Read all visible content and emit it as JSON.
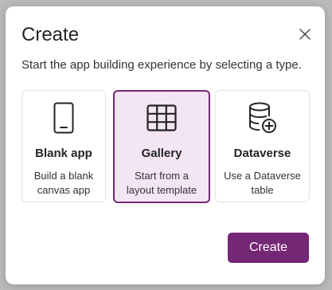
{
  "dialog": {
    "title": "Create",
    "subtitle": "Start the app building experience by selecting a type.",
    "close_icon": "close-icon"
  },
  "options": [
    {
      "id": "blank-app",
      "name": "Blank app",
      "description": "Build a blank canvas app",
      "icon": "phone-icon",
      "selected": false
    },
    {
      "id": "gallery",
      "name": "Gallery",
      "description": "Start from a layout template",
      "icon": "grid-icon",
      "selected": true
    },
    {
      "id": "dataverse",
      "name": "Dataverse",
      "description": "Use a Dataverse table",
      "icon": "database-add-icon",
      "selected": false
    }
  ],
  "footer": {
    "create_label": "Create"
  },
  "colors": {
    "accent": "#742774",
    "selected_background": "#f3e5f3"
  }
}
